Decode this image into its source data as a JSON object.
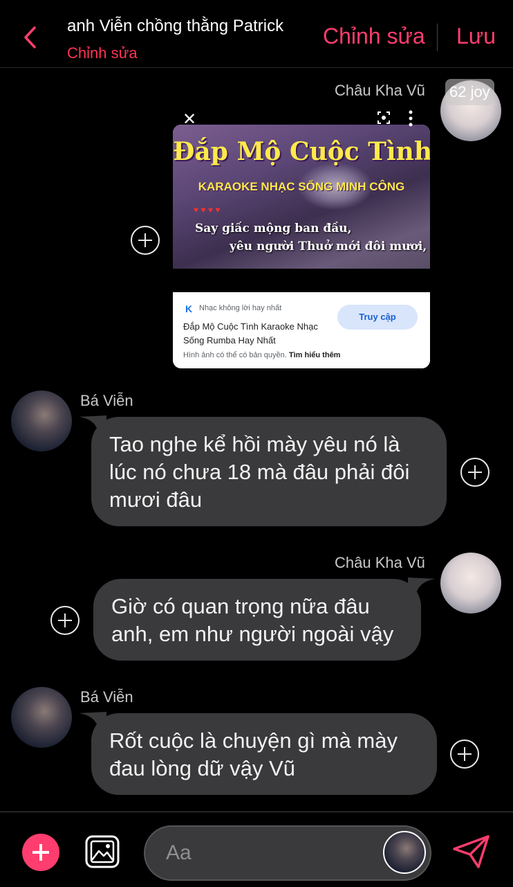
{
  "header": {
    "title": "anh Viễn chồng thằng Patrick",
    "subtitle": "Chỉnh sửa",
    "edit_label": "Chỉnh sửa",
    "save_label": "Lưu"
  },
  "colors": {
    "accent": "#ff3d6e",
    "subtitle": "#ff3355",
    "bubble": "#3a3a3c",
    "background": "#000000"
  },
  "messages": [
    {
      "sender": "Châu Kha Vũ",
      "badge": "62 joy",
      "type": "image-card",
      "card": {
        "thumb_title": "Đắp Mộ Cuộc Tình",
        "thumb_subtitle": "KARAOKE NHẠC SỐNG MINH CÔNG",
        "thumb_lyric_1": "Say giấc mộng ban đầu,",
        "thumb_lyric_2": "yêu người Thuở mới đôi mươi,",
        "source_logo": "K",
        "source_name": "Nhạc không lời hay nhất",
        "result_title": "Đắp Mộ Cuộc Tình Karaoke Nhạc Sống Rumba Hay Nhất",
        "visit_label": "Truy cập",
        "copyright": "Hình ảnh có thể có bản quyền.",
        "learn_more": "Tìm hiểu thêm"
      }
    },
    {
      "sender": "Bá Viễn",
      "text": "Tao nghe kể hồi mày yêu nó là lúc nó chưa 18 mà đâu phải đôi mươi đâu"
    },
    {
      "sender": "Châu Kha Vũ",
      "text": "Giờ có quan trọng nữa đâu anh, em như người ngoài vậy"
    },
    {
      "sender": "Bá Viễn",
      "text": "Rốt cuộc là chuyện gì mà mày đau lòng dữ vậy Vũ"
    }
  ],
  "composer": {
    "placeholder": "Aa"
  },
  "icons": {
    "back": "chevron-left-icon",
    "add": "plus-icon",
    "gallery": "image-icon",
    "send": "paper-plane-icon",
    "react": "plus-circle-icon"
  }
}
